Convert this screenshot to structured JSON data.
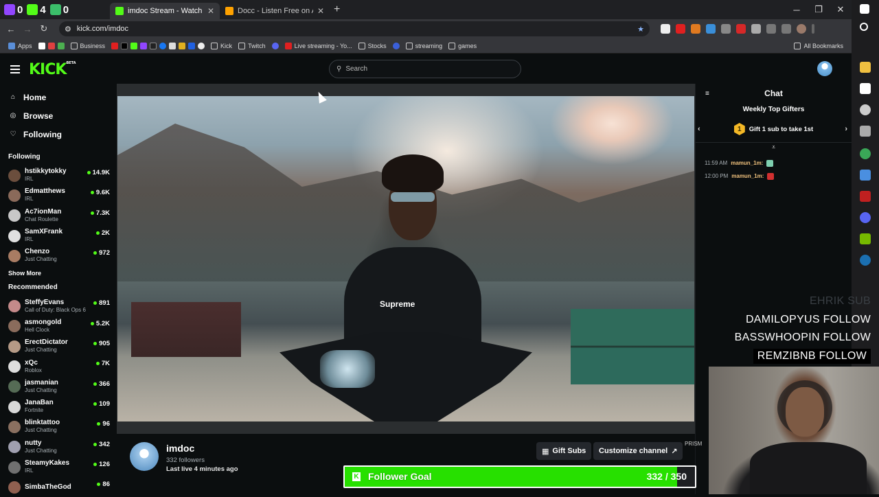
{
  "browser": {
    "counters": [
      {
        "icon": "twitch-icon",
        "value": "0",
        "color": "#9146ff"
      },
      {
        "icon": "kick-icon",
        "value": "4",
        "color": "#53fc18"
      },
      {
        "icon": "clover-icon",
        "value": "0",
        "color": "#3bbf6a"
      }
    ],
    "tabs": [
      {
        "title": "imdoc Stream - Watch Live on Kick",
        "active": true,
        "icon": "kick-icon"
      },
      {
        "title": "Docc - Listen Free on Audiomack",
        "active": false,
        "icon": "audiomack-icon"
      }
    ],
    "address": "kick.com/imdoc",
    "bookmarks": [
      "Apps",
      "Business",
      "Kick",
      "Twitch",
      "Live streaming - Yo...",
      "Stocks",
      "streaming",
      "games"
    ],
    "all_bookmarks": "All Bookmarks"
  },
  "kick": {
    "search_placeholder": "Search",
    "nav": [
      {
        "label": "Home",
        "icon": "home-icon"
      },
      {
        "label": "Browse",
        "icon": "compass-icon"
      },
      {
        "label": "Following",
        "icon": "heart-icon"
      }
    ],
    "following_title": "Following",
    "following": [
      {
        "name": "hstikkytokky",
        "category": "IRL",
        "viewers": "14.9K",
        "color": "#6b4e3d"
      },
      {
        "name": "Edmatthews",
        "category": "IRL",
        "viewers": "9.6K",
        "color": "#8a6a5a"
      },
      {
        "name": "Ac7ionMan",
        "category": "Chat Roulette",
        "viewers": "7.3K",
        "color": "#c8c8c8"
      },
      {
        "name": "SamXFrank",
        "category": "IRL",
        "viewers": "2K",
        "color": "#e0e0e0"
      },
      {
        "name": "Chenzo",
        "category": "Just Chatting",
        "viewers": "972",
        "color": "#a87c63"
      }
    ],
    "show_more": "Show More",
    "recommended_title": "Recommended",
    "recommended": [
      {
        "name": "SteffyEvans",
        "category": "Call of Duty: Black Ops 6",
        "viewers": "891",
        "color": "#c48a8a"
      },
      {
        "name": "asmongold",
        "category": "Hell Clock",
        "viewers": "5.2K",
        "color": "#8a6c5c"
      },
      {
        "name": "ErectDictator",
        "category": "Just Chatting",
        "viewers": "905",
        "color": "#b59a86"
      },
      {
        "name": "xQc",
        "category": "Roblox",
        "viewers": "7K",
        "color": "#dedede"
      },
      {
        "name": "jasmanian",
        "category": "Just Chatting",
        "viewers": "366",
        "color": "#556b55"
      },
      {
        "name": "JanaBan",
        "category": "Fortnite",
        "viewers": "109",
        "color": "#d8d8d8"
      },
      {
        "name": "blinktattoo",
        "category": "Just Chatting",
        "viewers": "96",
        "color": "#8a7060"
      },
      {
        "name": "nutty",
        "category": "Just Chatting",
        "viewers": "342",
        "color": "#a0a0b0"
      },
      {
        "name": "SteamyKakes",
        "category": "IRL",
        "viewers": "126",
        "color": "#707070"
      },
      {
        "name": "SimbaTheGod",
        "category": "",
        "viewers": "86",
        "color": "#906050"
      }
    ],
    "channel": {
      "name": "imdoc",
      "followers": "332 followers",
      "last_live": "Last live 4 minutes ago",
      "gift_subs": "Gift Subs",
      "customize": "Customize channel"
    },
    "chat": {
      "title": "Chat",
      "top_gifters": "Weekly Top Gifters",
      "gift_badge": "1",
      "gift_text": "Gift 1 sub to take 1st",
      "messages": [
        {
          "time": "11:59 AM",
          "user": "mamun_1m:"
        },
        {
          "time": "12:00 PM",
          "user": "mamun_1m:"
        }
      ]
    },
    "alerts": [
      {
        "name": "EHRIK",
        "action": "SUB",
        "faded": true
      },
      {
        "name": "DAMILOPYUS",
        "action": "FOLLOW",
        "faded": false
      },
      {
        "name": "BASSWHOOPIN",
        "action": "FOLLOW",
        "faded": false
      },
      {
        "name": "REMZIBNB",
        "action": "FOLLOW",
        "faded": false
      }
    ],
    "goal": {
      "label": "Follower Goal",
      "current": 332,
      "target": 350,
      "text": "332 / 350"
    },
    "prism": "PRISM"
  }
}
